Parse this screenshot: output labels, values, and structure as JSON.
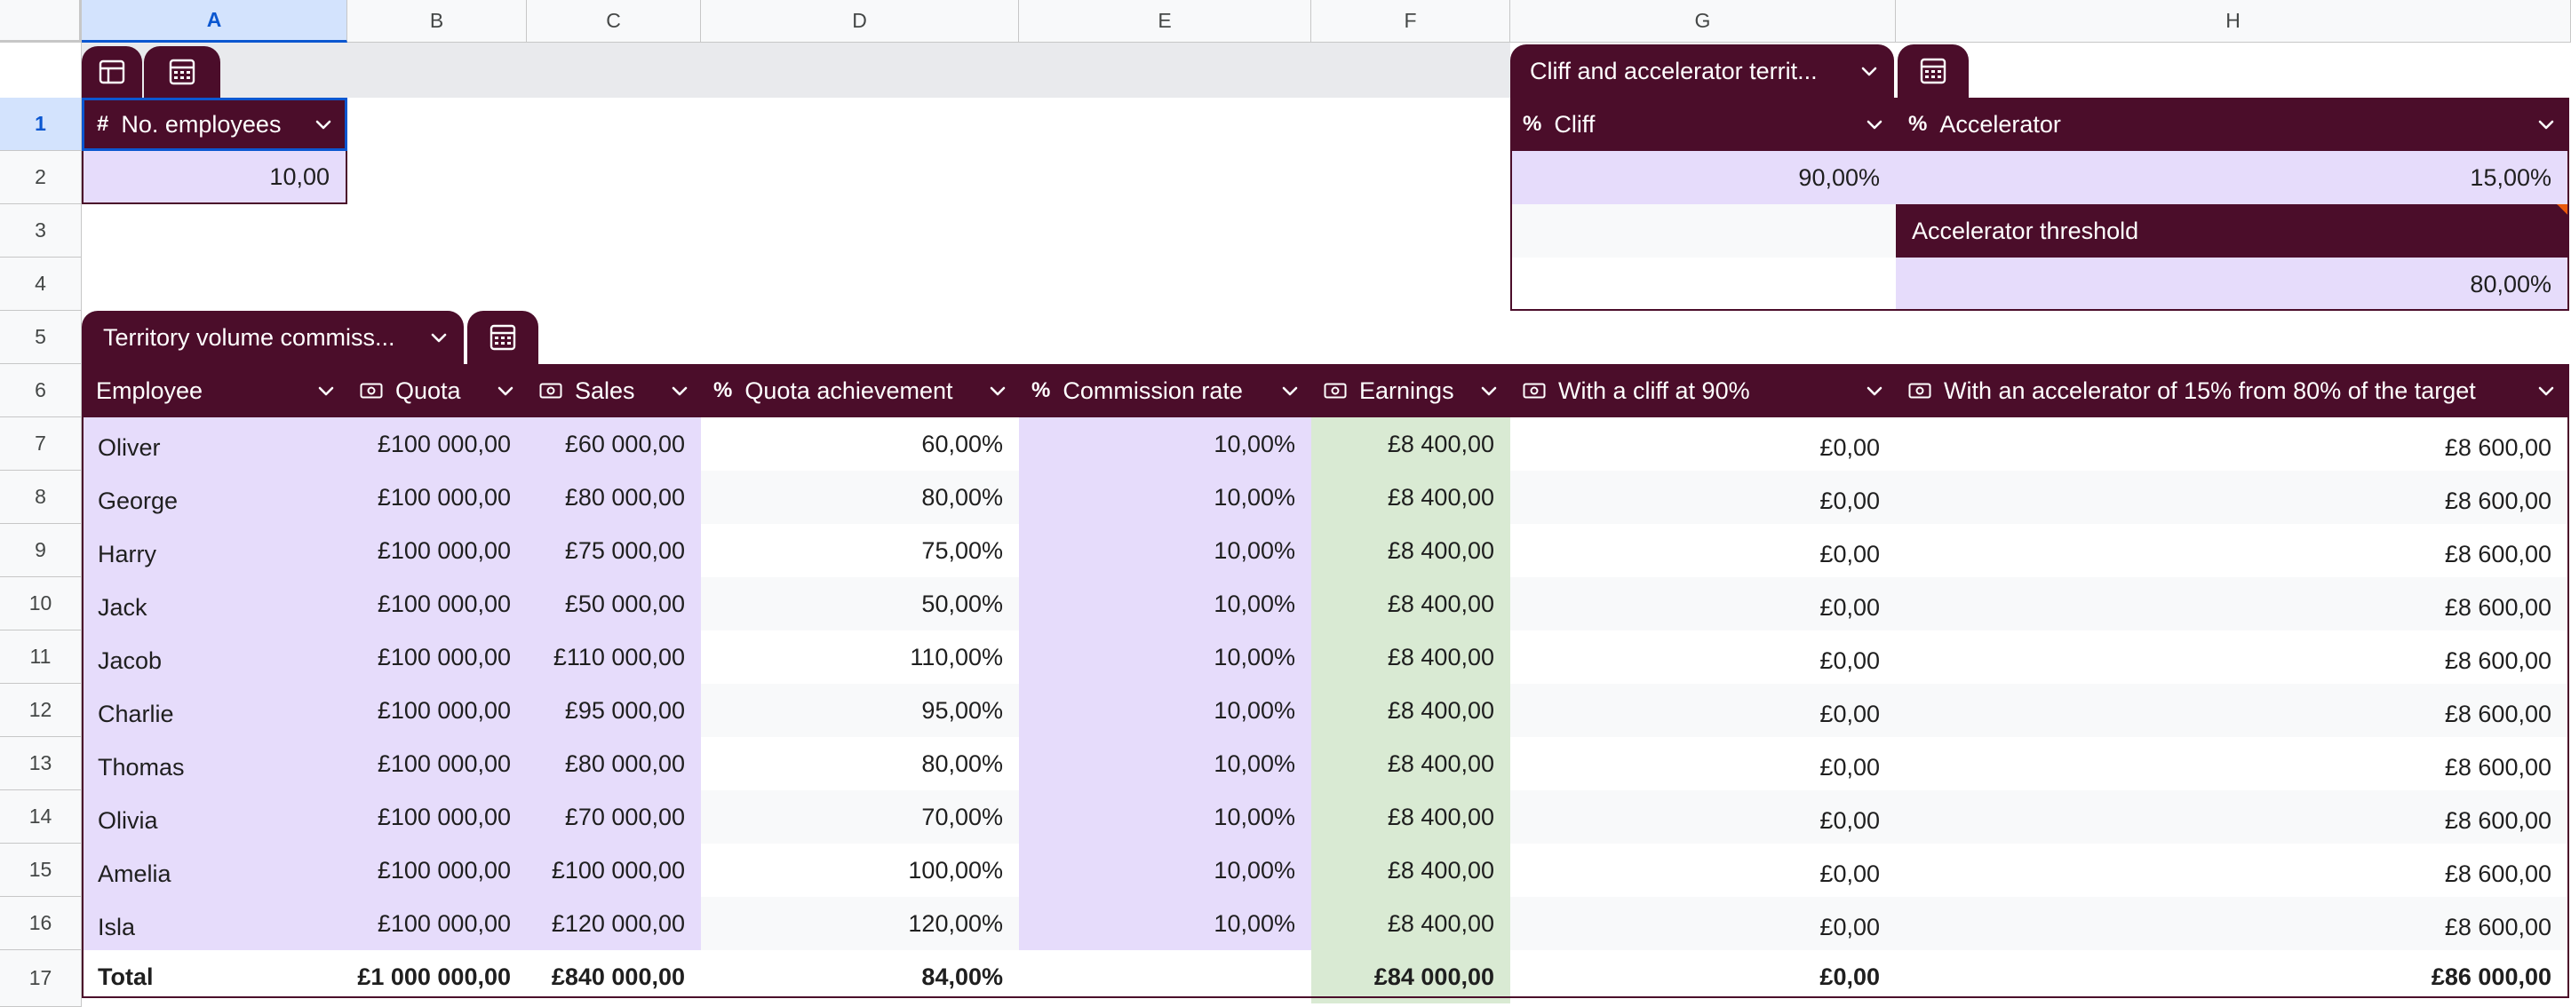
{
  "columns": [
    "A",
    "B",
    "C",
    "D",
    "E",
    "F",
    "G",
    "H"
  ],
  "rows": [
    "1",
    "2",
    "3",
    "4",
    "5",
    "6",
    "7",
    "8",
    "9",
    "10",
    "11",
    "12",
    "13",
    "14",
    "15",
    "16",
    "17"
  ],
  "employees_table": {
    "header": "No. employees",
    "value": "10,00"
  },
  "cliff_table": {
    "title": "Cliff and accelerator territ...",
    "cliff_label": "Cliff",
    "accelerator_label": "Accelerator",
    "cliff_value": "90,00%",
    "accelerator_value": "15,00%",
    "threshold_label": "Accelerator threshold",
    "threshold_value": "80,00%"
  },
  "commission_table": {
    "title": "Territory volume commiss...",
    "headers": [
      "Employee",
      "Quota",
      "Sales",
      "Quota achievement",
      "Commission rate",
      "Earnings",
      "With a cliff at 90%",
      "With an accelerator of 15% from 80% of the target"
    ],
    "rows": [
      [
        "Oliver",
        "£100 000,00",
        "£60 000,00",
        "60,00%",
        "10,00%",
        "£8 400,00",
        "£0,00",
        "£8 600,00"
      ],
      [
        "George",
        "£100 000,00",
        "£80 000,00",
        "80,00%",
        "10,00%",
        "£8 400,00",
        "£0,00",
        "£8 600,00"
      ],
      [
        "Harry",
        "£100 000,00",
        "£75 000,00",
        "75,00%",
        "10,00%",
        "£8 400,00",
        "£0,00",
        "£8 600,00"
      ],
      [
        "Jack",
        "£100 000,00",
        "£50 000,00",
        "50,00%",
        "10,00%",
        "£8 400,00",
        "£0,00",
        "£8 600,00"
      ],
      [
        "Jacob",
        "£100 000,00",
        "£110 000,00",
        "110,00%",
        "10,00%",
        "£8 400,00",
        "£0,00",
        "£8 600,00"
      ],
      [
        "Charlie",
        "£100 000,00",
        "£95 000,00",
        "95,00%",
        "10,00%",
        "£8 400,00",
        "£0,00",
        "£8 600,00"
      ],
      [
        "Thomas",
        "£100 000,00",
        "£80 000,00",
        "80,00%",
        "10,00%",
        "£8 400,00",
        "£0,00",
        "£8 600,00"
      ],
      [
        "Olivia",
        "£100 000,00",
        "£70 000,00",
        "70,00%",
        "10,00%",
        "£8 400,00",
        "£0,00",
        "£8 600,00"
      ],
      [
        "Amelia",
        "£100 000,00",
        "£100 000,00",
        "100,00%",
        "10,00%",
        "£8 400,00",
        "£0,00",
        "£8 600,00"
      ],
      [
        "Isla",
        "£100 000,00",
        "£120 000,00",
        "120,00%",
        "10,00%",
        "£8 400,00",
        "£0,00",
        "£8 600,00"
      ]
    ],
    "total": [
      "Total",
      "£1 000 000,00",
      "£840 000,00",
      "84,00%",
      "",
      "£84 000,00",
      "£0,00",
      "£86 000,00"
    ]
  },
  "icons": {
    "hash": "#",
    "percent": "%",
    "currency": "money-icon",
    "table": "table-icon",
    "calculator": "calculator-icon",
    "chevron": "chevron-down-icon"
  },
  "colors": {
    "header_bg": "#4b0d2a",
    "input_bg": "#e6dcfb",
    "earnings_bg": "#d9ead3",
    "selection": "#0b57d0"
  }
}
